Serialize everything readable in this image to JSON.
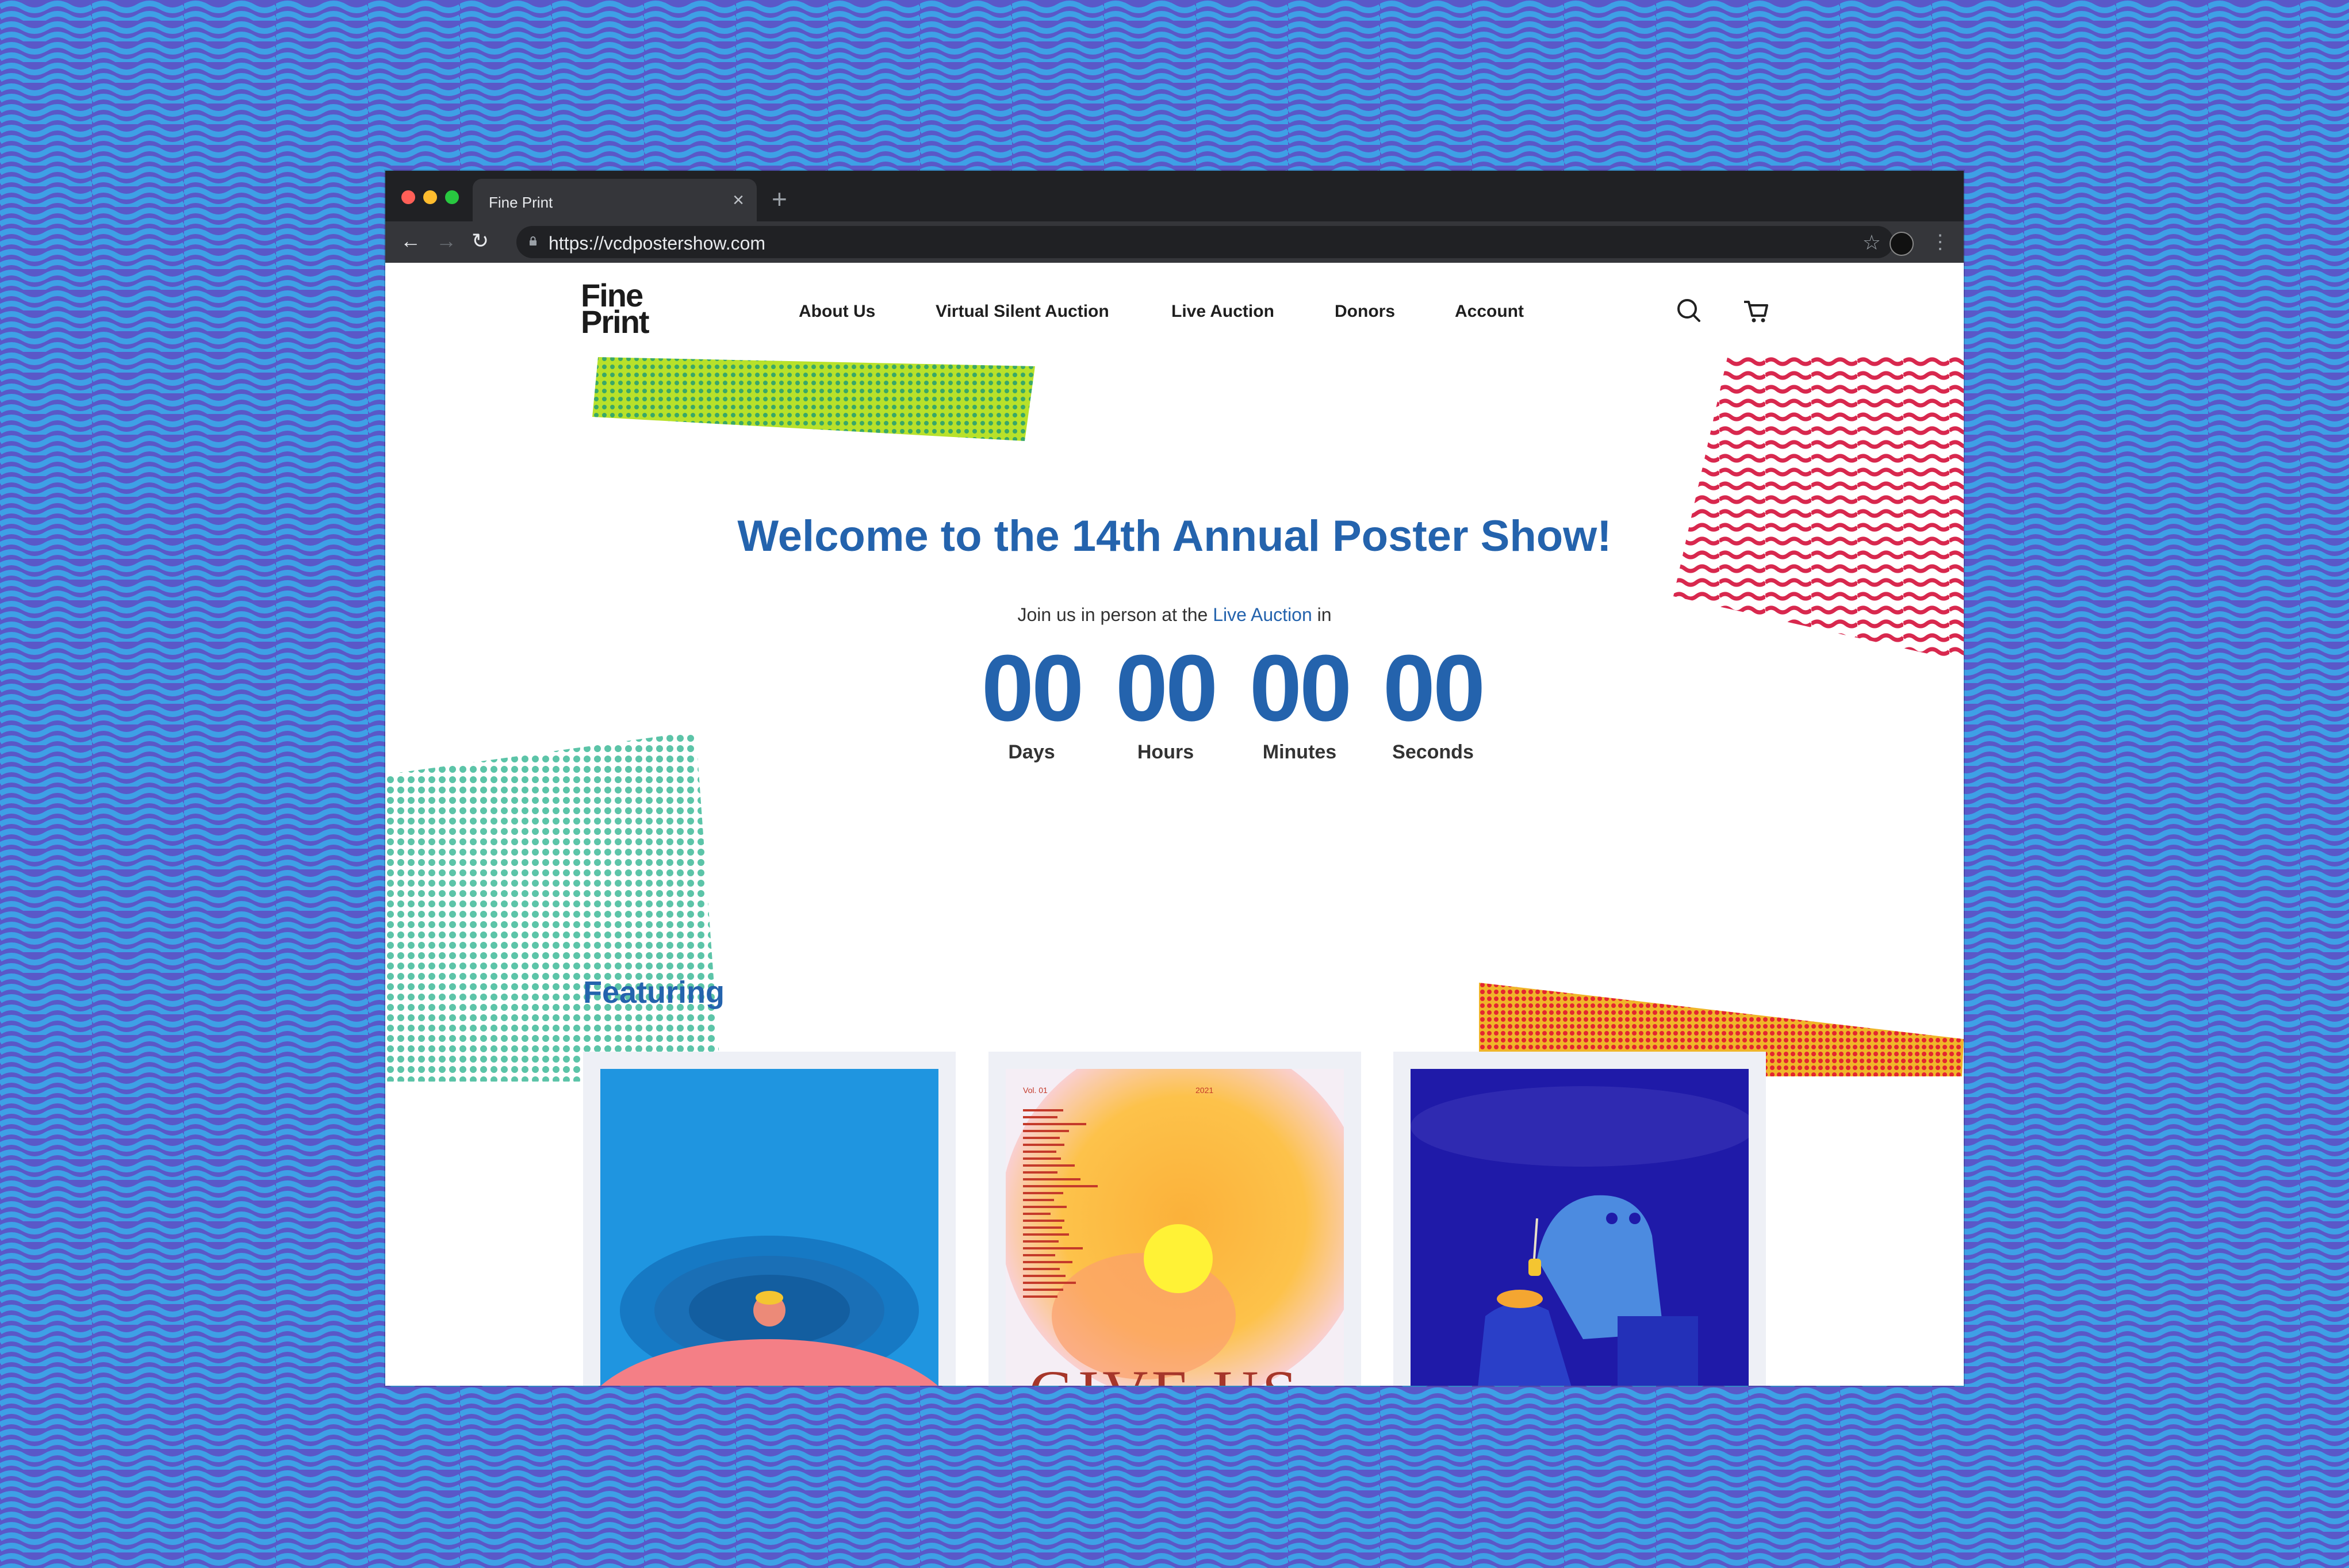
{
  "browser": {
    "tab_title": "Fine Print",
    "url": "https://vcdpostershow.com"
  },
  "site": {
    "logo_line1": "Fine",
    "logo_line2": "Print",
    "nav": [
      "About Us",
      "Virtual Silent Auction",
      "Live Auction",
      "Donors",
      "Account"
    ]
  },
  "hero": {
    "title": "Welcome to the 14th Annual Poster Show!",
    "subtitle_before": "Join us in person at the",
    "subtitle_link": "Live Auction",
    "subtitle_after": "in"
  },
  "countdown": [
    {
      "value": "00",
      "label": "Days"
    },
    {
      "value": "00",
      "label": "Hours"
    },
    {
      "value": "00",
      "label": "Minutes"
    },
    {
      "value": "00",
      "label": "Seconds"
    }
  ],
  "featuring": {
    "heading": "Featuring",
    "poster2_top_left": "Vol. 01",
    "poster2_top_right": "2021",
    "poster2_bottom_text": "GIVE US"
  },
  "colors": {
    "accent_blue": "#2463ad",
    "background_wave": "#5a58c8"
  }
}
